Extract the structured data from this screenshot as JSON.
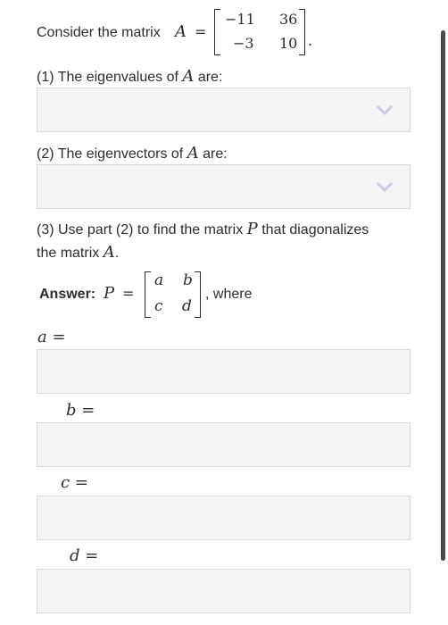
{
  "intro": {
    "prefix": "Consider the matrix",
    "var": "A",
    "eq": "=",
    "matrix": [
      "−11",
      "36",
      "−3",
      "10"
    ],
    "suffix": "."
  },
  "q1": {
    "text": "(1) The eigenvalues of",
    "var": "A",
    "tail": "are:"
  },
  "q2": {
    "text": "(2) The eigenvectors of",
    "var": "A",
    "tail": "are:"
  },
  "q3": {
    "line1_a": "(3) Use part (2) to find the matrix",
    "line1_var": "P",
    "line1_b": "that diagonalizes",
    "line2_a": "the matrix",
    "line2_var": "A",
    "line2_b": "."
  },
  "answer": {
    "label": "Answer:",
    "var": "P",
    "eq": "=",
    "matrix": [
      "a",
      "b",
      "c",
      "d"
    ],
    "suffix": ", where"
  },
  "fields": [
    {
      "label": "a =",
      "value": ""
    },
    {
      "label": "b =",
      "value": ""
    },
    {
      "label": "c =",
      "value": ""
    },
    {
      "label": "d =",
      "value": ""
    }
  ],
  "selects": [
    {
      "selected": ""
    },
    {
      "selected": ""
    }
  ],
  "icons": {
    "dropdown": "chevron-down-icon"
  },
  "colors": {
    "field_bg": "#f3f4f3",
    "field_border": "#d9dbd9",
    "chevron": "#c7c9e8",
    "text": "#2d2d2d"
  }
}
